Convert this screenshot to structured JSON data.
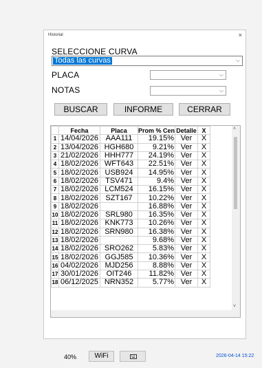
{
  "window": {
    "title": "Historial",
    "close_label": "×"
  },
  "curve": {
    "label": "SELECCIONE CURVA",
    "value": "Todas las curvas"
  },
  "placa": {
    "label": "PLACA",
    "value": ""
  },
  "notas": {
    "label": "NOTAS",
    "value": ""
  },
  "buttons": {
    "search": "BUSCAR",
    "report": "INFORME",
    "close": "CERRAR"
  },
  "table": {
    "headers": {
      "num": "",
      "fecha": "Fecha",
      "placa": "Placa",
      "prom": "Prom % Cen",
      "detalle": "Detalle",
      "x": "X"
    },
    "rows": [
      {
        "n": "1",
        "fecha": "14/04/2026",
        "placa": "AAA111",
        "prom": "19.15%",
        "detalle": "Ver",
        "x": "X"
      },
      {
        "n": "2",
        "fecha": "13/04/2026",
        "placa": "HGH680",
        "prom": "9.21%",
        "detalle": "Ver",
        "x": "X"
      },
      {
        "n": "3",
        "fecha": "21/02/2026",
        "placa": "HHH777",
        "prom": "24.19%",
        "detalle": "Ver",
        "x": "X"
      },
      {
        "n": "4",
        "fecha": "18/02/2026",
        "placa": "WFT643",
        "prom": "22.51%",
        "detalle": "Ver",
        "x": "X"
      },
      {
        "n": "5",
        "fecha": "18/02/2026",
        "placa": "USB924",
        "prom": "14.95%",
        "detalle": "Ver",
        "x": "X"
      },
      {
        "n": "6",
        "fecha": "18/02/2026",
        "placa": "TSV471",
        "prom": "9.4%",
        "detalle": "Ver",
        "x": "X"
      },
      {
        "n": "7",
        "fecha": "18/02/2026",
        "placa": "LCM524",
        "prom": "16.15%",
        "detalle": "Ver",
        "x": "X"
      },
      {
        "n": "8",
        "fecha": "18/02/2026",
        "placa": "SZT167",
        "prom": "10.22%",
        "detalle": "Ver",
        "x": "X"
      },
      {
        "n": "9",
        "fecha": "18/02/2026",
        "placa": "",
        "prom": "16.88%",
        "detalle": "Ver",
        "x": "X"
      },
      {
        "n": "10",
        "fecha": "18/02/2026",
        "placa": "SRL980",
        "prom": "16.35%",
        "detalle": "Ver",
        "x": "X"
      },
      {
        "n": "11",
        "fecha": "18/02/2026",
        "placa": "KNK773",
        "prom": "10.26%",
        "detalle": "Ver",
        "x": "X"
      },
      {
        "n": "12",
        "fecha": "18/02/2026",
        "placa": "SRN980",
        "prom": "16.38%",
        "detalle": "Ver",
        "x": "X"
      },
      {
        "n": "13",
        "fecha": "18/02/2026",
        "placa": "",
        "prom": "9.68%",
        "detalle": "Ver",
        "x": "X"
      },
      {
        "n": "14",
        "fecha": "18/02/2026",
        "placa": "SRO262",
        "prom": "5.83%",
        "detalle": "Ver",
        "x": "X"
      },
      {
        "n": "15",
        "fecha": "18/02/2026",
        "placa": "GGJ585",
        "prom": "10.36%",
        "detalle": "Ver",
        "x": "X"
      },
      {
        "n": "16",
        "fecha": "04/02/2026",
        "placa": "MJD256",
        "prom": "8.88%",
        "detalle": "Ver",
        "x": "X"
      },
      {
        "n": "17",
        "fecha": "30/01/2026",
        "placa": "OIT246",
        "prom": "11.82%",
        "detalle": "Ver",
        "x": "X"
      },
      {
        "n": "18",
        "fecha": "06/12/2025",
        "placa": "NRN352",
        "prom": "5.77%",
        "detalle": "Ver",
        "x": "X"
      }
    ]
  },
  "statusbar": {
    "battery": "40%",
    "wifi": "WiFi",
    "keyboard_icon": "keyboard-icon",
    "clock": "2026-04-14 15:22"
  },
  "colors": {
    "selection": "#0078d7",
    "clock": "#0050d0"
  }
}
